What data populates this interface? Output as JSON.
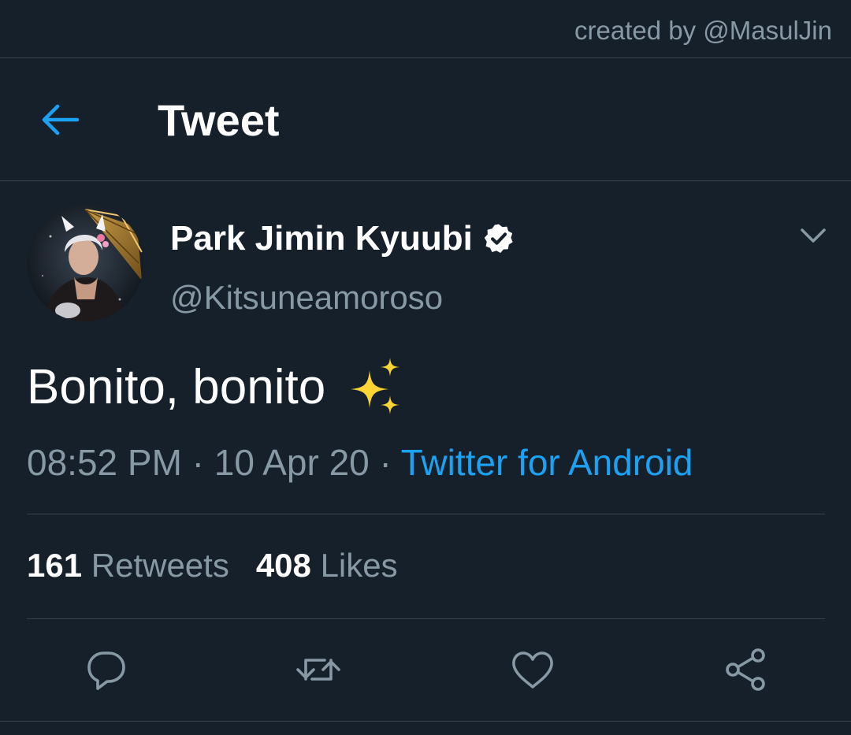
{
  "credit": "created by @MasulJin",
  "header": {
    "title": "Tweet",
    "back_icon": "arrow-left-icon"
  },
  "colors": {
    "background": "#15202b",
    "accent": "#1da1f2",
    "secondary_text": "#8899a6",
    "border": "#38444d"
  },
  "tweet": {
    "author_name": "Park Jimin Kyuubi",
    "verified": true,
    "handle": "@Kitsuneamoroso",
    "text": "Bonito, bonito",
    "emoji": "sparkles",
    "time": "08:52 PM",
    "date": "10 Apr 20",
    "separator": " · ",
    "source": "Twitter for Android",
    "retweets_count": "161",
    "retweets_label": "Retweets",
    "likes_count": "408",
    "likes_label": "Likes"
  },
  "actions": [
    "reply-icon",
    "retweet-icon",
    "like-icon",
    "share-icon"
  ]
}
